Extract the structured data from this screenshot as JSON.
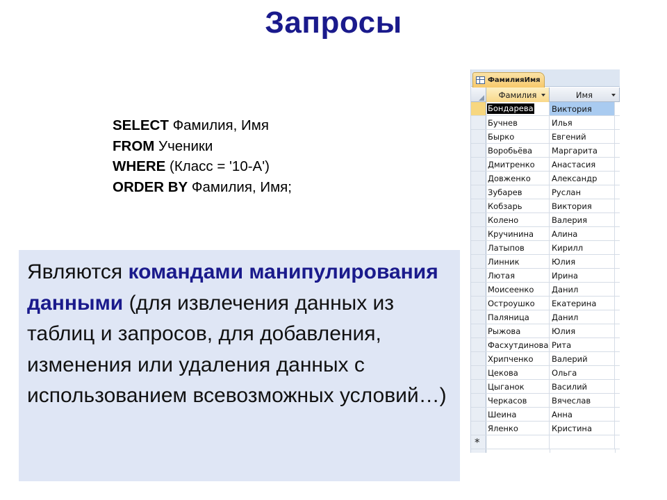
{
  "slide": {
    "title": "Запросы"
  },
  "sql": {
    "lines": [
      {
        "keyword": "SELECT",
        "text": " Фамилия, Имя"
      },
      {
        "keyword": "FROM",
        "text": " Ученики"
      },
      {
        "keyword": "WHERE",
        "text": " (Класс = '10-А')"
      },
      {
        "keyword": "ORDER BY",
        "text": " Фамилия, Имя;"
      }
    ]
  },
  "info": {
    "prefix": "Являются ",
    "highlight": "командами манипулирования данными",
    "suffix": " (для извлечения данных из таблиц и запросов, для добавления, изменения или удаления данных с использованием всевозможных условий…)"
  },
  "datasheet": {
    "tab_label": "ФамилияИмя",
    "tab_icon": "query-icon",
    "columns": [
      "Фамилия",
      "Имя"
    ],
    "rows": [
      [
        "Бондарева",
        "Виктория"
      ],
      [
        "Бучнев",
        "Илья"
      ],
      [
        "Бырко",
        "Евгений"
      ],
      [
        "Воробьёва",
        "Маргарита"
      ],
      [
        "Дмитренко",
        "Анастасия"
      ],
      [
        "Довженко",
        "Александр"
      ],
      [
        "Зубарев",
        "Руслан"
      ],
      [
        "Кобзарь",
        "Виктория"
      ],
      [
        "Колено",
        "Валерия"
      ],
      [
        "Кручинина",
        "Алина"
      ],
      [
        "Латыпов",
        "Кирилл"
      ],
      [
        "Линник",
        "Юлия"
      ],
      [
        "Лютая",
        "Ирина"
      ],
      [
        "Моисеенко",
        "Данил"
      ],
      [
        "Остроушко",
        "Екатерина"
      ],
      [
        "Паляница",
        "Данил"
      ],
      [
        "Рыжова",
        "Юлия"
      ],
      [
        "Фасхутдинова",
        "Рита"
      ],
      [
        "Хрипченко",
        "Валерий"
      ],
      [
        "Цекова",
        "Ольга"
      ],
      [
        "Цыганок",
        "Василий"
      ],
      [
        "Черкасов",
        "Вячеслав"
      ],
      [
        "Шеина",
        "Анна"
      ],
      [
        "Яленко",
        "Кристина"
      ]
    ],
    "current_row": 0,
    "new_record_marker": "*",
    "colors": {
      "tab_bg": "#f7c96b",
      "selected_header": "#f9d889",
      "selected_cell": "#a9cbf0"
    }
  },
  "colors": {
    "title": "#1a1a8c",
    "info_box_bg": "#dfe6f5",
    "highlight": "#1a1a8c"
  }
}
